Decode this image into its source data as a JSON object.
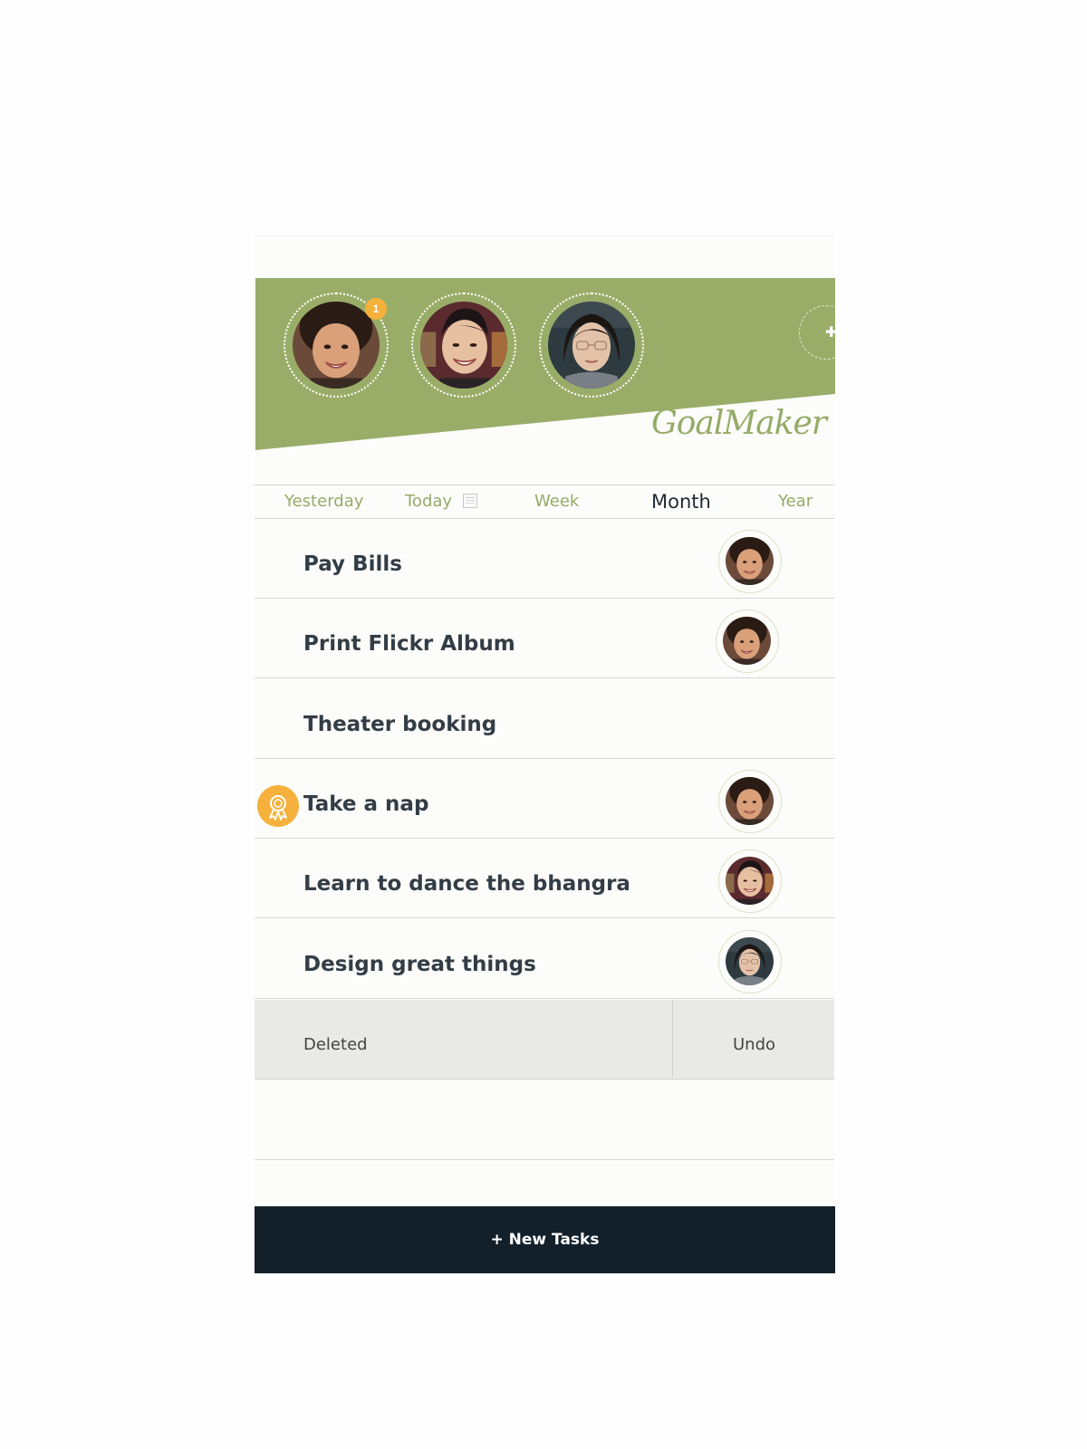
{
  "header": {
    "background_color": "#99ad68",
    "logo_text": "GoalMaker",
    "members": [
      {
        "name": "member-1",
        "badge": "1"
      },
      {
        "name": "member-2",
        "badge": ""
      },
      {
        "name": "member-3",
        "badge": ""
      }
    ],
    "add_member_icon": "plus-icon",
    "add_member_symbol": "✚"
  },
  "tabs": [
    {
      "label": "Yesterday",
      "active": false
    },
    {
      "label": "Today",
      "active": false,
      "icon": "calendar-icon"
    },
    {
      "label": "Week",
      "active": false
    },
    {
      "label": "Month",
      "active": true
    },
    {
      "label": "Year",
      "active": false
    }
  ],
  "tasks": [
    {
      "title": "Pay Bills",
      "assignee": "member-1"
    },
    {
      "title": "Print Flickr Album",
      "assignee": "member-1"
    },
    {
      "title": "Theater booking",
      "assignee": ""
    },
    {
      "title": "Take a nap",
      "assignee": "member-1",
      "icon": "award-icon"
    },
    {
      "title": "Learn to dance the bhangra",
      "assignee": "member-2"
    },
    {
      "title": "Design great things",
      "assignee": "member-3"
    }
  ],
  "deleted_bar": {
    "label": "Deleted",
    "undo_label": "Undo"
  },
  "footer": {
    "new_tasks_label": "+ New Tasks",
    "button_color": "#13202a"
  },
  "colors": {
    "accent_green": "#95ab68",
    "badge_orange": "#f5b13b",
    "text_dark": "#333d46"
  }
}
